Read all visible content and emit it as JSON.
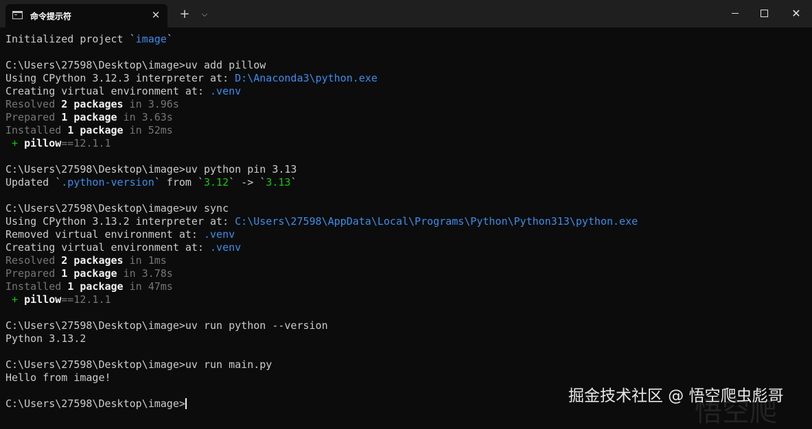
{
  "window": {
    "tab_title": "命令提示符",
    "close_tab_glyph": "✕",
    "new_tab_glyph": "+",
    "dropdown_glyph": "⌵",
    "close_glyph": "✕"
  },
  "colors": {
    "background": "#0c0c0c",
    "titlebar": "#1f1f1f",
    "text": "#cccccc",
    "dim": "#767676",
    "link": "#3b8eea",
    "success": "#16c60c"
  },
  "terminal": {
    "lines": [
      [
        {
          "t": "Initialized project `",
          "c": "normal"
        },
        {
          "t": "image",
          "c": "blue"
        },
        {
          "t": "`",
          "c": "normal"
        }
      ],
      [],
      [
        {
          "t": "C:\\Users\\27598\\Desktop\\image>uv add pillow",
          "c": "normal"
        }
      ],
      [
        {
          "t": "Using CPython 3.12.3 interpreter at: ",
          "c": "normal"
        },
        {
          "t": "D:\\Anaconda3\\python.exe",
          "c": "blue"
        }
      ],
      [
        {
          "t": "Creating virtual environment at: ",
          "c": "normal"
        },
        {
          "t": ".venv",
          "c": "blue"
        }
      ],
      [
        {
          "t": "Resolved ",
          "c": "dim"
        },
        {
          "t": "2 packages",
          "c": "bold"
        },
        {
          "t": " in 3.96s",
          "c": "dim"
        }
      ],
      [
        {
          "t": "Prepared ",
          "c": "dim"
        },
        {
          "t": "1 package",
          "c": "bold"
        },
        {
          "t": " in 3.63s",
          "c": "dim"
        }
      ],
      [
        {
          "t": "Installed ",
          "c": "dim"
        },
        {
          "t": "1 package",
          "c": "bold"
        },
        {
          "t": " in 52ms",
          "c": "dim"
        }
      ],
      [
        {
          "t": " + ",
          "c": "green"
        },
        {
          "t": "pillow",
          "c": "bold"
        },
        {
          "t": "==12.1.1",
          "c": "dim"
        }
      ],
      [],
      [
        {
          "t": "C:\\Users\\27598\\Desktop\\image>uv python pin 3.13",
          "c": "normal"
        }
      ],
      [
        {
          "t": "Updated `",
          "c": "normal"
        },
        {
          "t": ".python-version",
          "c": "blue"
        },
        {
          "t": "` from `",
          "c": "normal"
        },
        {
          "t": "3.12",
          "c": "green"
        },
        {
          "t": "` -> `",
          "c": "normal"
        },
        {
          "t": "3.13",
          "c": "green"
        },
        {
          "t": "`",
          "c": "normal"
        }
      ],
      [],
      [
        {
          "t": "C:\\Users\\27598\\Desktop\\image>uv sync",
          "c": "normal"
        }
      ],
      [
        {
          "t": "Using CPython 3.13.2 interpreter at: ",
          "c": "normal"
        },
        {
          "t": "C:\\Users\\27598\\AppData\\Local\\Programs\\Python\\Python313\\python.exe",
          "c": "blue"
        }
      ],
      [
        {
          "t": "Removed virtual environment at: ",
          "c": "normal"
        },
        {
          "t": ".venv",
          "c": "blue"
        }
      ],
      [
        {
          "t": "Creating virtual environment at: ",
          "c": "normal"
        },
        {
          "t": ".venv",
          "c": "blue"
        }
      ],
      [
        {
          "t": "Resolved ",
          "c": "dim"
        },
        {
          "t": "2 packages",
          "c": "bold"
        },
        {
          "t": " in 1ms",
          "c": "dim"
        }
      ],
      [
        {
          "t": "Prepared ",
          "c": "dim"
        },
        {
          "t": "1 package",
          "c": "bold"
        },
        {
          "t": " in 3.78s",
          "c": "dim"
        }
      ],
      [
        {
          "t": "Installed ",
          "c": "dim"
        },
        {
          "t": "1 package",
          "c": "bold"
        },
        {
          "t": " in 47ms",
          "c": "dim"
        }
      ],
      [
        {
          "t": " + ",
          "c": "green"
        },
        {
          "t": "pillow",
          "c": "bold"
        },
        {
          "t": "==12.1.1",
          "c": "dim"
        }
      ],
      [],
      [
        {
          "t": "C:\\Users\\27598\\Desktop\\image>uv run python --version",
          "c": "normal"
        }
      ],
      [
        {
          "t": "Python 3.13.2",
          "c": "normal"
        }
      ],
      [],
      [
        {
          "t": "C:\\Users\\27598\\Desktop\\image>uv run main.py",
          "c": "normal"
        }
      ],
      [
        {
          "t": "Hello from image!",
          "c": "normal"
        }
      ],
      [],
      [
        {
          "t": "C:\\Users\\27598\\Desktop\\image>",
          "c": "normal"
        }
      ]
    ]
  },
  "watermark": {
    "text": "掘金技术社区 @ 悟空爬虫彪哥",
    "ghost": "悟空爬"
  }
}
